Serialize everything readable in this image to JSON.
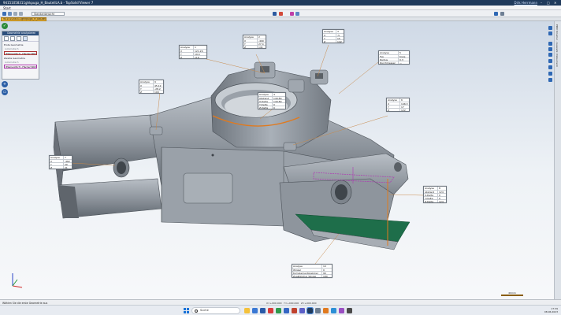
{
  "window": {
    "title": "94151058311ghkpuga_H_BautellLA.b ‐ TopSolid'Viewer 7",
    "user": "Dirk Herrmann",
    "controls": [
      "–",
      "□",
      "✕"
    ]
  },
  "menu": {
    "start_label": "Start"
  },
  "toolbar": {
    "view_select_value": "Standardansicht"
  },
  "file_tab": {
    "label": "94151058311ghkpuga_H_BautellLA"
  },
  "geometry_panel": {
    "title": "Geometrie analysieren",
    "first_label": "Erste Geometrie",
    "first_sub": "Automatisch",
    "first_value": "[Element]1(7): Fläche(7463",
    "second_label": "Zweite Geometrie",
    "second_sub": "Automatisch",
    "second_value": "[Element]1(7): Fläche(7463"
  },
  "side_tab": {
    "label": "PDM Struktur · Auswahl / Dokument"
  },
  "analysis_boxes": [
    {
      "rows": [
        [
          "Analyse",
          "2"
        ],
        [
          "X",
          "-490"
        ],
        [
          "Y",
          "27.4"
        ],
        [
          "Z",
          "141"
        ]
      ]
    },
    {
      "rows": [
        [
          "Analyse",
          "3"
        ],
        [
          "X",
          "-5"
        ],
        [
          "Y",
          "15"
        ],
        [
          "Z",
          "142"
        ]
      ]
    },
    {
      "rows": [
        [
          "Analyse",
          "1"
        ],
        [
          "X",
          "121.26"
        ],
        [
          "Y",
          "19.4"
        ],
        [
          "Z",
          "116"
        ]
      ]
    },
    {
      "rows": [
        [
          "Analyse",
          "5"
        ],
        [
          "Typ",
          "Kreis"
        ],
        [
          "Radius",
          "0.3"
        ],
        [
          "Durchmesser",
          "—"
        ]
      ]
    },
    {
      "rows": [
        [
          "Analyse",
          "9"
        ],
        [
          "X",
          "45.12"
        ],
        [
          "Y",
          "-28.2"
        ],
        [
          "Z",
          "100"
        ]
      ]
    },
    {
      "rows": [
        [
          "Analyse",
          "4"
        ],
        [
          "Abstand",
          "149.89"
        ],
        [
          "X-Delta",
          "149.89"
        ],
        [
          "Y-Delta",
          "0"
        ],
        [
          "Z-Delta",
          "0"
        ]
      ]
    },
    {
      "rows": [
        [
          "Analyse",
          "6"
        ],
        [
          "X",
          "146.3"
        ],
        [
          "Y",
          "17"
        ],
        [
          "Z",
          "122"
        ]
      ]
    },
    {
      "rows": [
        [
          "Analyse",
          "7"
        ],
        [
          "X",
          "-462"
        ],
        [
          "Y",
          "20"
        ],
        [
          "Z",
          "21"
        ]
      ]
    },
    {
      "rows": [
        [
          "Analyse",
          "8"
        ],
        [
          "Abstand",
          "124"
        ],
        [
          "X-Delta",
          "0"
        ],
        [
          "Y-Delta",
          "0"
        ],
        [
          "Z-Delta",
          "124"
        ]
      ]
    },
    {
      "rows": [
        [
          "Analyse",
          "10"
        ],
        [
          "Winkel",
          "0"
        ],
        [
          "Komplementärwinkel",
          "90"
        ],
        [
          "Zusätzlicher Winkel",
          "180"
        ]
      ]
    }
  ],
  "scale": {
    "label": "40mm"
  },
  "status": {
    "hint": "Wählen Sie die erste Geometrie aus",
    "coords": [
      "X=+000.000",
      "Y=+000.000",
      "Z=+000.000"
    ]
  },
  "taskbar": {
    "search_placeholder": "Suche",
    "time": "17:39",
    "date": "08.06.2023"
  },
  "colors": {
    "accent": "#2c4f7c",
    "orange": "#e07a1f",
    "purple": "#b03ab4",
    "green": "#1e6e4a"
  }
}
